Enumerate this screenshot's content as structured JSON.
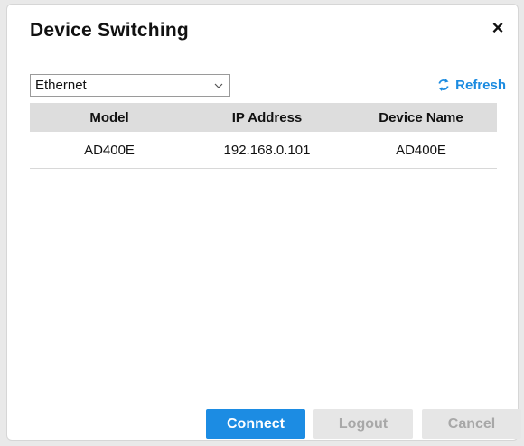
{
  "dialog": {
    "title": "Device Switching",
    "close_label": "×"
  },
  "connection_type": {
    "selected": "Ethernet",
    "icon": "chevron-down-icon"
  },
  "refresh": {
    "label": "Refresh",
    "icon": "refresh-icon",
    "color": "#1b8be0"
  },
  "table": {
    "headers": [
      "Model",
      "IP Address",
      "Device Name"
    ],
    "rows": [
      {
        "model": "AD400E",
        "ip_address": "192.168.0.101",
        "device_name": "AD400E"
      }
    ]
  },
  "buttons": {
    "connect_label": "Connect",
    "logout_label": "Logout",
    "cancel_label": "Cancel",
    "connect_color": "#1c8ce3"
  }
}
